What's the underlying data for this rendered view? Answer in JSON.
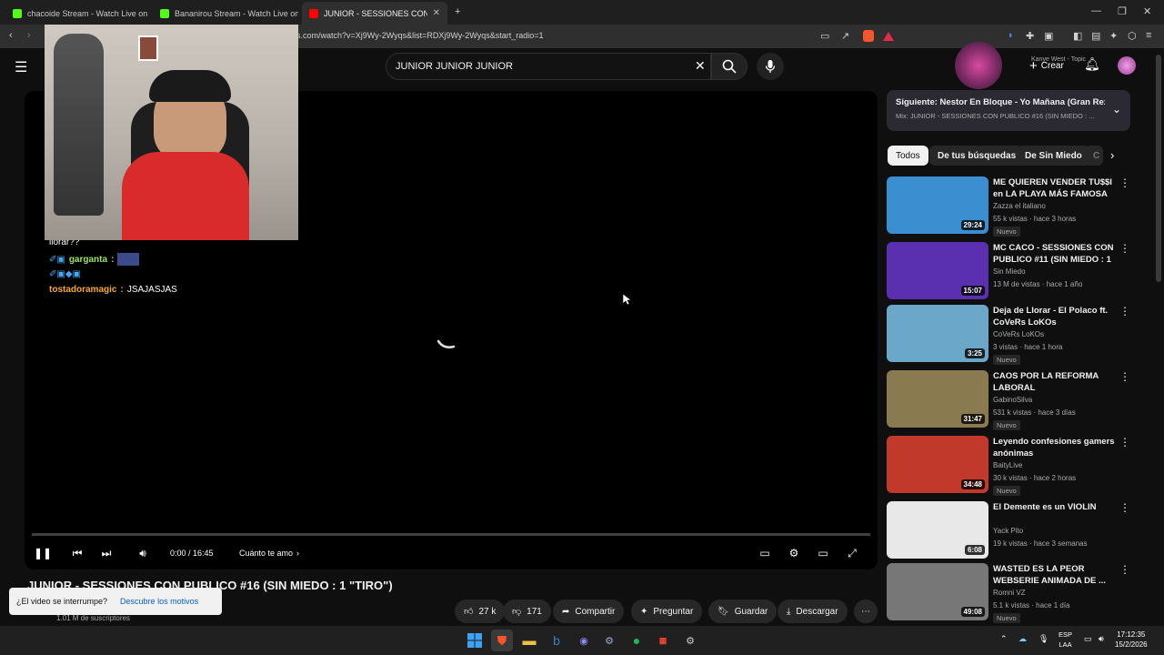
{
  "browser": {
    "tabs": [
      {
        "title": "chacoide Stream - Watch Live on",
        "color": "#53fc18"
      },
      {
        "title": "Bananirou Stream - Watch Live on",
        "color": "#53fc18"
      },
      {
        "title": "JUNIOR - SESSIONES CON PUBLI...",
        "color": "#ff0000",
        "active": true
      }
    ],
    "new_tab": "+",
    "url": "s.com/watch?v=Xj9Wy-2Wyqs&list=RDXj9Wy-2Wyqs&start_radio=1"
  },
  "youtube": {
    "search_value": "JUNIOR JUNIOR JUNIOR",
    "create_label": "Crear",
    "mini_player_label": "Kanye West - Topic"
  },
  "stream_overlay": {
    "chat": [
      {
        "user": "",
        "text": "llorar??"
      },
      {
        "user": "garganta",
        "text": ""
      },
      {
        "user": "tostadoramagic",
        "text": "JSAJASJAS"
      }
    ]
  },
  "player": {
    "time": "0:00 / 16:45",
    "chapter": "Cuánto te amo",
    "progress": 0
  },
  "video": {
    "title": "JUNIOR - SESSIONES CON PUBLICO #16 (SIN MIEDO : 1 \"TIRO\")",
    "subscribers": "1.01 M de suscriptores",
    "likes": "27 k",
    "dislikes": "171",
    "share": "Compartir",
    "ask": "Preguntar",
    "save": "Guardar",
    "download": "Descargar"
  },
  "toast": {
    "text": "¿El video se interrumpe?",
    "link": "Descubre los motivos"
  },
  "up_next": {
    "title": "Siguiente: Nestor En Bloque - Yo Mañana (Gran Rex...",
    "subtitle": "Mix: JUNIOR - SESSIONES CON PUBLICO #16 (SIN MIEDO : ..."
  },
  "chips": [
    "Todos",
    "De tus búsquedas",
    "De Sin Miedo",
    "C"
  ],
  "recommendations": [
    {
      "title": "ME QUIEREN VENDER TU$$I en LA PLAYA MÁS FAMOSA DEL ...",
      "channel": "Zazza el italiano",
      "meta": "55 k vistas · hace 3 horas",
      "duration": "29:24",
      "badge": "Nuevo",
      "thumb_color": "#3b8fd0"
    },
    {
      "title": "MC CACO - SESSIONES CON PUBLICO #11 (SIN MIEDO : 1 ...",
      "channel": "Sin Miedo",
      "meta": "13 M de vistas · hace 1 año",
      "duration": "15:07",
      "badge": "",
      "thumb_color": "#5a2fb0"
    },
    {
      "title": "Deja de Llorar - El Polaco  ft. CoVeRs LoKOs",
      "channel": "CoVeRs LoKOs",
      "meta": "3 vistas · hace 1 hora",
      "duration": "3:25",
      "badge": "Nuevo",
      "thumb_color": "#6aa7c8"
    },
    {
      "title": "CAOS POR LA REFORMA LABORAL",
      "channel": "GabinoSilva",
      "meta": "531 k vistas · hace 3 días",
      "duration": "31:47",
      "badge": "Nuevo",
      "thumb_color": "#8a7a50"
    },
    {
      "title": "Leyendo confesiones gamers anónimas",
      "channel": "BaityLive",
      "meta": "30 k vistas · hace 2 horas",
      "duration": "34:48",
      "badge": "Nuevo",
      "thumb_color": "#c0392b"
    },
    {
      "title": "El Demente es un VIOLIN",
      "channel": "Yack Pito",
      "meta": "19 k vistas · hace 3 semanas",
      "duration": "6:08",
      "badge": "",
      "thumb_color": "#e8e8e8"
    },
    {
      "title": "WASTED ES LA PEOR WEBSERIE ANIMADA DE ...",
      "channel": "Romni VZ",
      "meta": "5.1 k vistas · hace 1 día",
      "duration": "49:08",
      "badge": "Nuevo",
      "thumb_color": "#777777"
    }
  ],
  "taskbar": {
    "lang": "ESP",
    "lang_sub": "LAA",
    "time": "17:12:35",
    "date": "15/2/2026"
  }
}
